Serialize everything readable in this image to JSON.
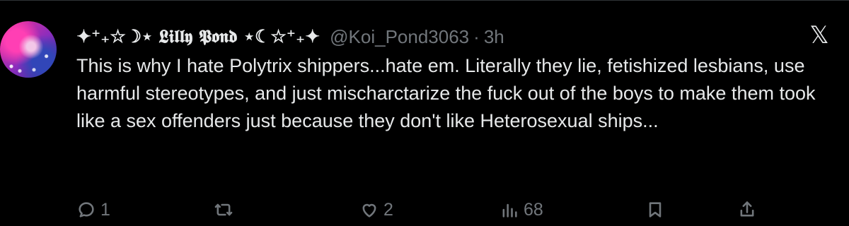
{
  "tweet": {
    "display_name": "✦⁺₊☆☽⋆ 𝕷𝖎𝖑𝖑𝖞 𝕻𝖔𝖓𝖉 ⋆☾☆⁺₊✦",
    "handle": "@Koi_Pond3063",
    "separator": "·",
    "time": "3h",
    "text": "This is why I hate Polytrix shippers...hate em. Literally they lie, fetishized lesbians, use harmful stereotypes, and just mischarctarize the fuck out of the boys to make them took like a sex offenders just because they don't like Heterosexual ships...",
    "close_label": "𝕏"
  },
  "actions": {
    "reply": {
      "count": "1",
      "icon": "reply-icon"
    },
    "repost": {
      "count": "",
      "icon": "repost-icon"
    },
    "like": {
      "count": "2",
      "icon": "heart-icon"
    },
    "views": {
      "count": "68",
      "icon": "views-icon"
    },
    "bookmark": {
      "icon": "bookmark-icon"
    },
    "share": {
      "icon": "share-icon"
    }
  },
  "colors": {
    "background": "#000000",
    "text": "#e7e9ea",
    "secondary": "#71767b"
  }
}
